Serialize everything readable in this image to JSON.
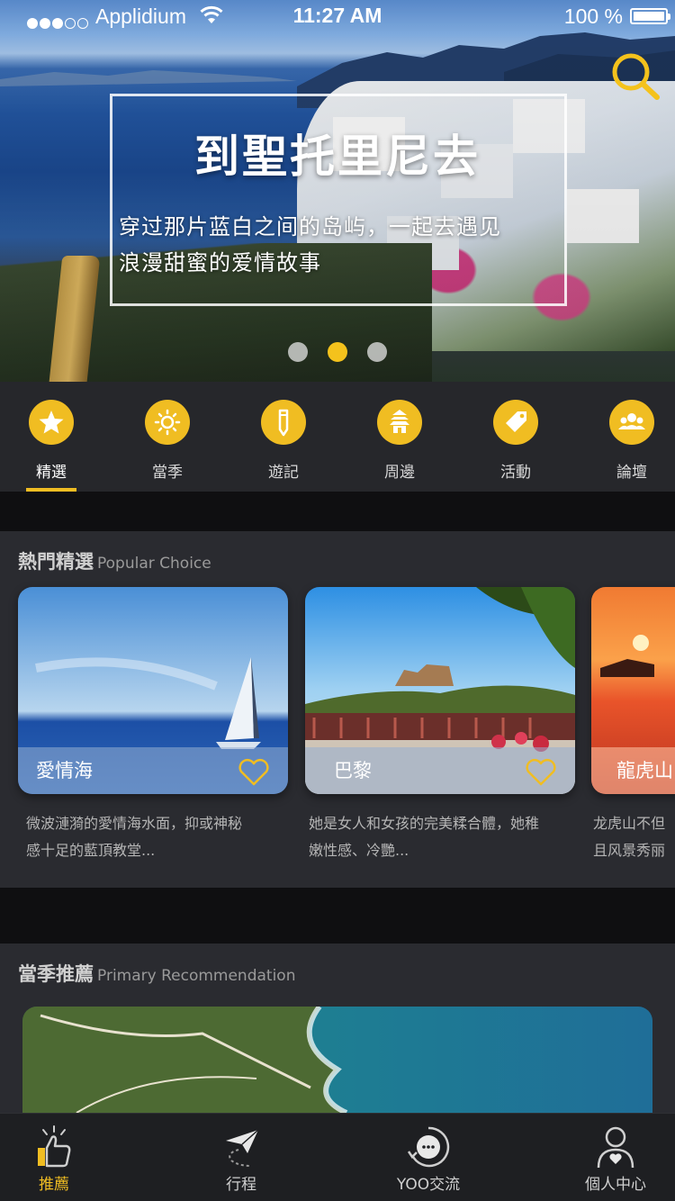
{
  "status_bar": {
    "carrier": "Applidium",
    "time": "11:27 AM",
    "battery": "100 %"
  },
  "hero": {
    "title": "到聖托里尼去",
    "subtitle_line1": "穿过那片蓝白之间的岛屿，一起去遇见",
    "subtitle_line2": "浪漫甜蜜的爱情故事",
    "pager_total": 3,
    "pager_active": 2
  },
  "categories": [
    {
      "label": "精選",
      "icon": "star-icon",
      "active": true
    },
    {
      "label": "當季",
      "icon": "sun-icon",
      "active": false
    },
    {
      "label": "遊記",
      "icon": "pencil-icon",
      "active": false
    },
    {
      "label": "周邊",
      "icon": "pagoda-icon",
      "active": false
    },
    {
      "label": "活動",
      "icon": "tag-icon",
      "active": false
    },
    {
      "label": "論壇",
      "icon": "people-icon",
      "active": false
    }
  ],
  "popular": {
    "title_cn": "熱門精選",
    "title_en": "Popular Choice",
    "cards": [
      {
        "name": "愛情海",
        "desc_line1": "微波漣漪的愛情海水面，抑或神秘",
        "desc_line2": "感十足的藍頂教堂..."
      },
      {
        "name": "巴黎",
        "desc_line1": "她是女人和女孩的完美糅合體，她稚",
        "desc_line2": "嫩性感、冷艷..."
      },
      {
        "name": "龍虎山",
        "desc_line1": "龙虎山不但",
        "desc_line2": "且风景秀丽"
      }
    ]
  },
  "seasonal": {
    "title_cn": "當季推薦",
    "title_en": "Primary Recommendation"
  },
  "tab_bar": {
    "tabs": [
      {
        "label": "推薦",
        "icon": "thumbs-up-icon",
        "active": true
      },
      {
        "label": "行程",
        "icon": "paper-plane-icon",
        "active": false
      },
      {
        "label": "YOO交流",
        "icon": "chat-bubble-icon",
        "active": false
      },
      {
        "label": "個人中心",
        "icon": "user-icon",
        "active": false
      }
    ]
  },
  "colors": {
    "accent": "#f0bd22",
    "background": "#242529",
    "section": "#2a2b30"
  }
}
